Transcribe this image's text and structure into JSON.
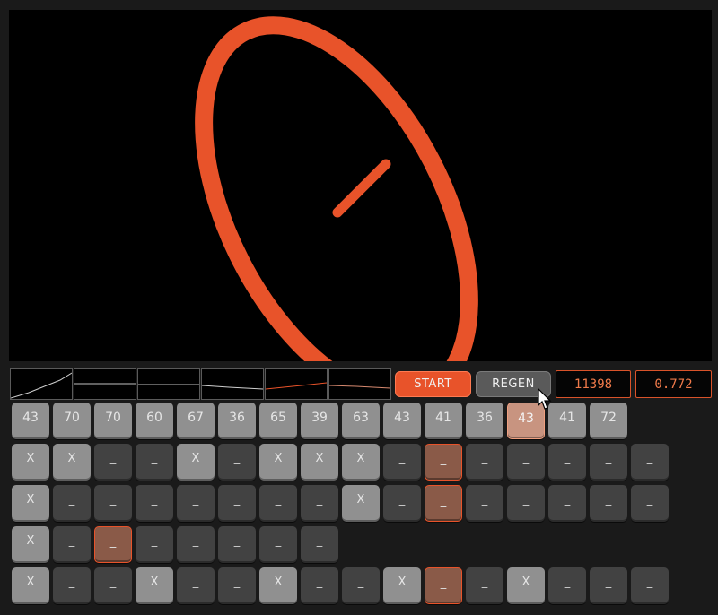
{
  "controls": {
    "start_label": "START",
    "regen_label": "REGEN",
    "counter": "11398",
    "ratio": "0.772"
  },
  "colors": {
    "accent": "#e8532a",
    "background": "#000000"
  },
  "curves": [
    "curve-1",
    "curve-2",
    "curve-3",
    "curve-4",
    "curve-5",
    "curve-6"
  ],
  "notes": [
    "43",
    "70",
    "70",
    "60",
    "67",
    "36",
    "65",
    "39",
    "63",
    "43",
    "41",
    "36",
    "43",
    "41",
    "72"
  ],
  "grid_rows": [
    [
      "X",
      "X",
      "_",
      "_",
      "X",
      "_",
      "X",
      "X",
      "X",
      "_",
      "_",
      "_",
      "_",
      "_",
      "_",
      "_"
    ],
    [
      "X",
      "_",
      "_",
      "_",
      "_",
      "_",
      "_",
      "_",
      "X",
      "_",
      "_",
      "_",
      "_",
      "_",
      "_",
      "_"
    ],
    [
      "X",
      "_",
      "_",
      "_",
      "_",
      "_",
      "_",
      "_"
    ],
    [
      "X",
      "_",
      "_",
      "X",
      "_",
      "_",
      "X",
      "_",
      "_",
      "X",
      "_",
      "_",
      "X",
      "_",
      "_",
      "_"
    ]
  ]
}
